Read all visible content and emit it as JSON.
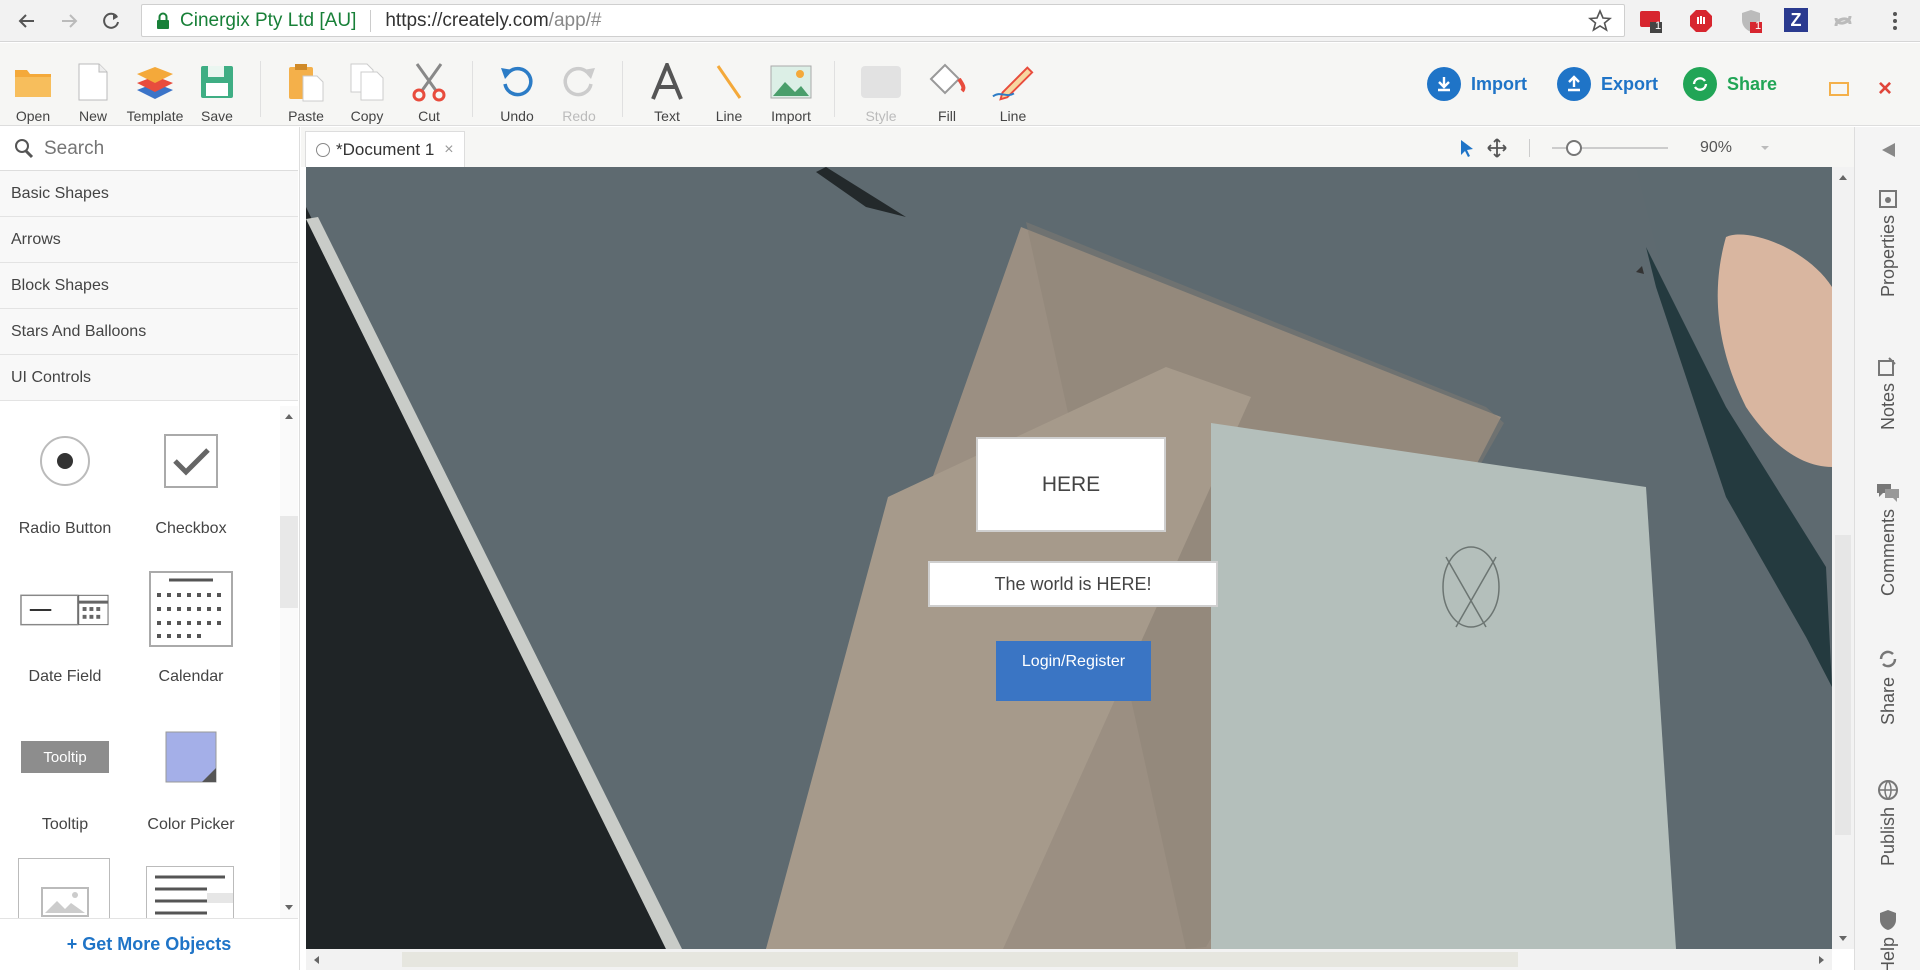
{
  "browser": {
    "site_name": "Cinergix Pty Ltd [AU]",
    "url_host": "https://creately.com",
    "url_path": "/app/#",
    "ext_badge_1": "1",
    "ext_badge_2": "1",
    "ext_z": "Z"
  },
  "toolbar": {
    "open": "Open",
    "new": "New",
    "template": "Template",
    "save": "Save",
    "paste": "Paste",
    "copy": "Copy",
    "cut": "Cut",
    "undo": "Undo",
    "redo": "Redo",
    "text": "Text",
    "line": "Line",
    "import": "Import",
    "style": "Style",
    "fill": "Fill",
    "line2": "Line",
    "import_btn": "Import",
    "export_btn": "Export",
    "share_btn": "Share",
    "close_glyph": "×"
  },
  "library": {
    "search_placeholder": "Search",
    "categories": [
      "Basic Shapes",
      "Arrows",
      "Block Shapes",
      "Stars And Balloons",
      "UI Controls"
    ],
    "shapes": [
      "Radio Button",
      "Checkbox",
      "Date Field",
      "Calendar",
      "Tooltip",
      "Color Picker"
    ],
    "tooltip_thumb_text": "Tooltip",
    "get_more": "+ Get More Objects"
  },
  "document": {
    "tab_title": "*Document 1",
    "tab_close": "×",
    "zoom": "90%"
  },
  "canvas": {
    "heading_box": "HERE",
    "subtitle_box": "The world is HERE!",
    "login_button": "Login/Register"
  },
  "rail": {
    "properties": "Properties",
    "notes": "Notes",
    "comments": "Comments",
    "share": "Share",
    "publish": "Publish",
    "help": "Help"
  },
  "colors": {
    "accent_blue": "#1f74c7",
    "share_green": "#21a556",
    "login_blue": "#3a75c4",
    "close_red": "#e0453a"
  }
}
